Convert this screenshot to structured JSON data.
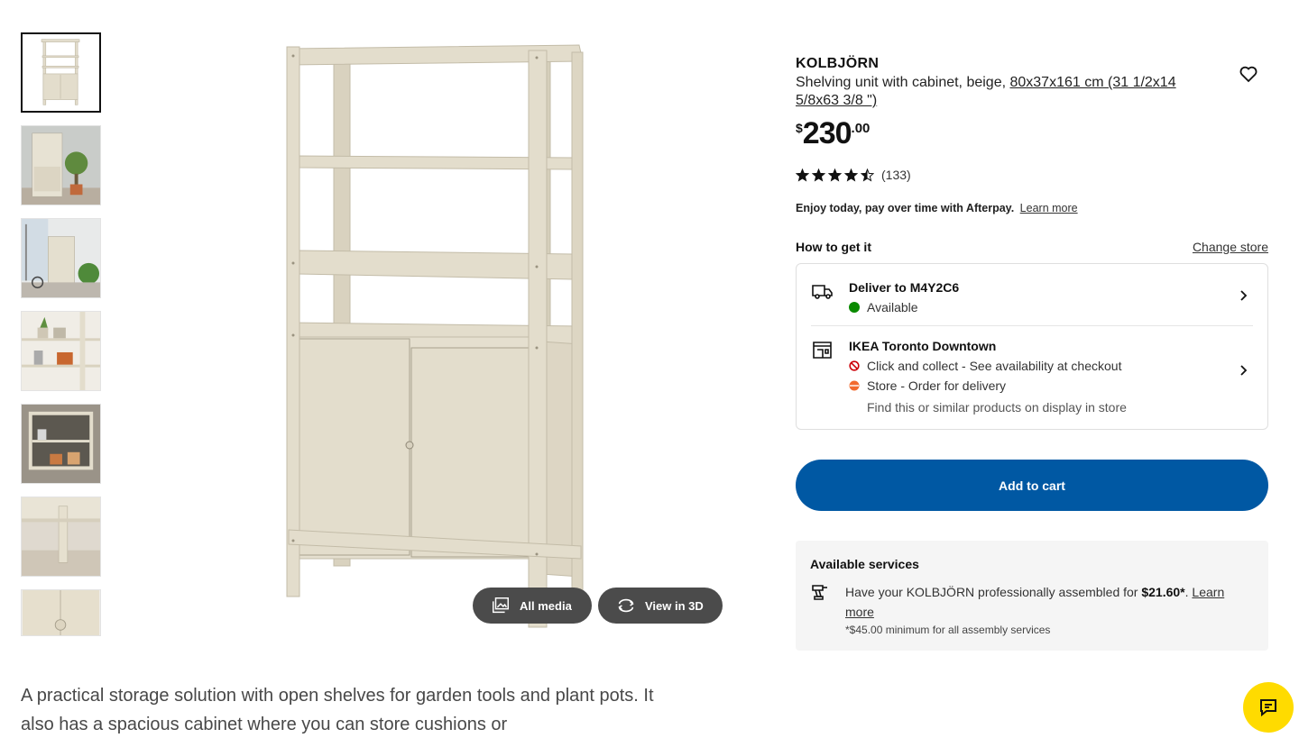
{
  "product": {
    "name": "KOLBJÖRN",
    "description_prefix": "Shelving unit with cabinet, beige, ",
    "dimensions": "80x37x161 cm (31 1/2x14 5/8x63 3/8 \")",
    "price_currency": "$",
    "price_integer": "230",
    "price_decimal": ".00",
    "rating_value": 4.5,
    "rating_max": 5,
    "review_count": "(133)"
  },
  "afterpay": {
    "text": "Enjoy today, pay over time with Afterpay.",
    "link": "Learn more"
  },
  "how_to_get": {
    "title": "How to get it",
    "change_store": "Change store",
    "delivery": {
      "title": "Deliver to M4Y2C6",
      "status": "Available",
      "status_color": "#0a8a00"
    },
    "store": {
      "title": "IKEA Toronto Downtown",
      "click_collect": "Click and collect - See availability at checkout",
      "click_collect_color": "#cc0008",
      "store_order": "Store - Order for delivery",
      "store_order_color": "#f26a2e",
      "display_note": "Find this or similar products on display in store"
    }
  },
  "add_to_cart": "Add to cart",
  "services": {
    "title": "Available services",
    "text_prefix": "Have your KOLBJÖRN professionally assembled for ",
    "price": "$21.60*",
    "text_suffix": ". ",
    "link": "Learn more",
    "note": "*$45.00 minimum for all assembly services"
  },
  "media": {
    "all_media": "All media",
    "view_3d": "View in 3D"
  },
  "description": "A practical storage solution with open shelves for garden tools and plant pots. It also has a spacious cabinet where you can store cushions or",
  "thumbnails": [
    "product-front",
    "lifestyle-garden",
    "lifestyle-balcony",
    "detail-plants",
    "detail-cabinet-open",
    "detail-legs",
    "detail-knob"
  ],
  "colors": {
    "brand_blue": "#0058a3",
    "chat_yellow": "#ffdb00",
    "unit_beige": "#e3ddcc"
  }
}
